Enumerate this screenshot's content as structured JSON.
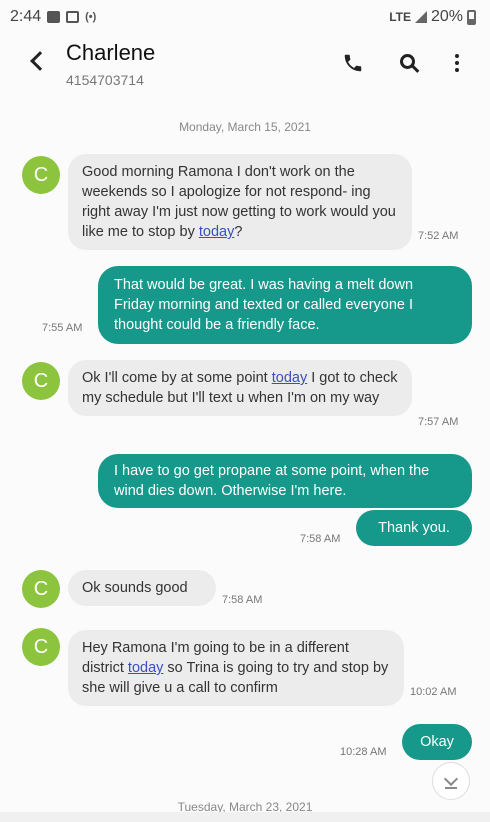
{
  "status_bar": {
    "time": "2:44",
    "carrier": "LTE",
    "battery": "20%",
    "extra": "(•)"
  },
  "header": {
    "name": "Charlene",
    "phone": "4154703714"
  },
  "dates": [
    "Monday, March 15, 2021",
    "Tuesday, March 23, 2021"
  ],
  "avatar_letter": "C",
  "messages": [
    {
      "dir": "in",
      "pre": "Good morning Ramona I don't work on the weekends so I apologize for not respond- ing right away I'm just now getting to work would you like me to stop by ",
      "link": "today",
      "post": "?",
      "time": "7:52 AM"
    },
    {
      "dir": "out",
      "text": "That would be great.   I was having a melt down Friday morning and texted or called everyone I thought could be a friendly face.",
      "time": "7:55 AM"
    },
    {
      "dir": "in",
      "pre": "Ok I'll come by at some point ",
      "link": "today",
      "post": " I got to check my schedule but I'll text u when I'm on my way",
      "time": "7:57 AM"
    },
    {
      "dir": "out",
      "text": "I have to go get propane at some point, when the wind dies down.  Otherwise I'm here.",
      "time": ""
    },
    {
      "dir": "out",
      "text": "Thank you.",
      "time": "7:58 AM"
    },
    {
      "dir": "in",
      "text": "Ok sounds good",
      "time": "7:58 AM"
    },
    {
      "dir": "in",
      "pre": "Hey Ramona I'm going to be in a different district ",
      "link": "today",
      "post": " so Trina is going to try and stop by she will give u a call to confirm",
      "time": "10:02 AM"
    },
    {
      "dir": "out",
      "text": "Okay",
      "time": "10:28 AM"
    }
  ],
  "colors": {
    "outgoing_bubble": "#16988a",
    "incoming_bubble": "#ececec",
    "avatar": "#8cc43e",
    "link": "#3a4fbf"
  },
  "icons": [
    "back-chevron-icon",
    "phone-icon",
    "search-icon",
    "more-vert-icon",
    "scroll-down-icon"
  ]
}
